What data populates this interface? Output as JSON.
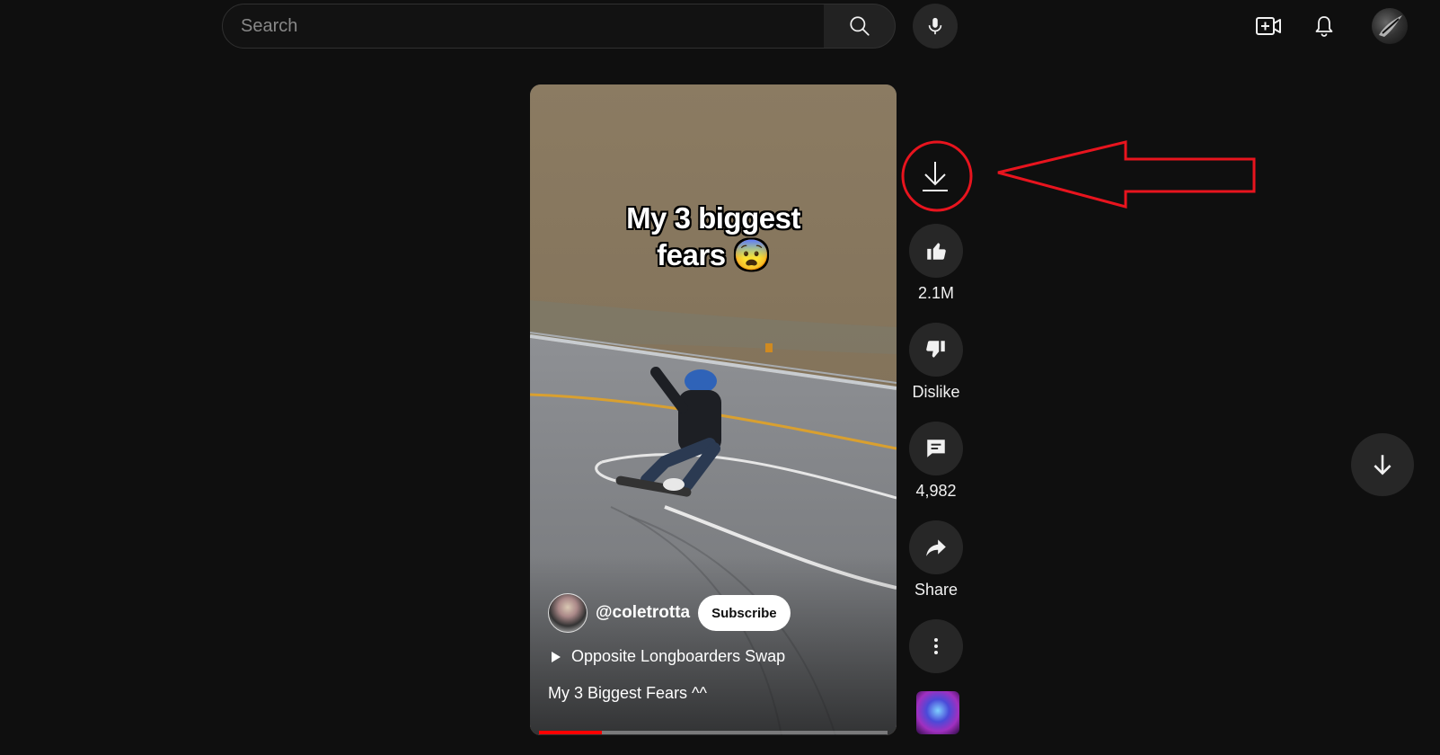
{
  "header": {
    "search_placeholder": "Search",
    "icons": [
      "search-icon",
      "mic-icon",
      "create-video-icon",
      "bell-icon",
      "avatar"
    ]
  },
  "video": {
    "overlay_title_line1": "My 3 biggest",
    "overlay_title_line2": "fears 😨",
    "channel_handle": "@coletrotta",
    "subscribe_label": "Subscribe",
    "playlist_label": "Opposite Longboarders Swap",
    "caption": "My 3 Biggest Fears ^^",
    "progress_fraction": 0.18
  },
  "actions": {
    "like_count": "2.1M",
    "dislike_label": "Dislike",
    "comment_count": "4,982",
    "share_label": "Share"
  },
  "colors": {
    "background": "#0f0f0f",
    "button": "#272727",
    "progress": "#ff0000",
    "annotation": "#e8141e"
  }
}
